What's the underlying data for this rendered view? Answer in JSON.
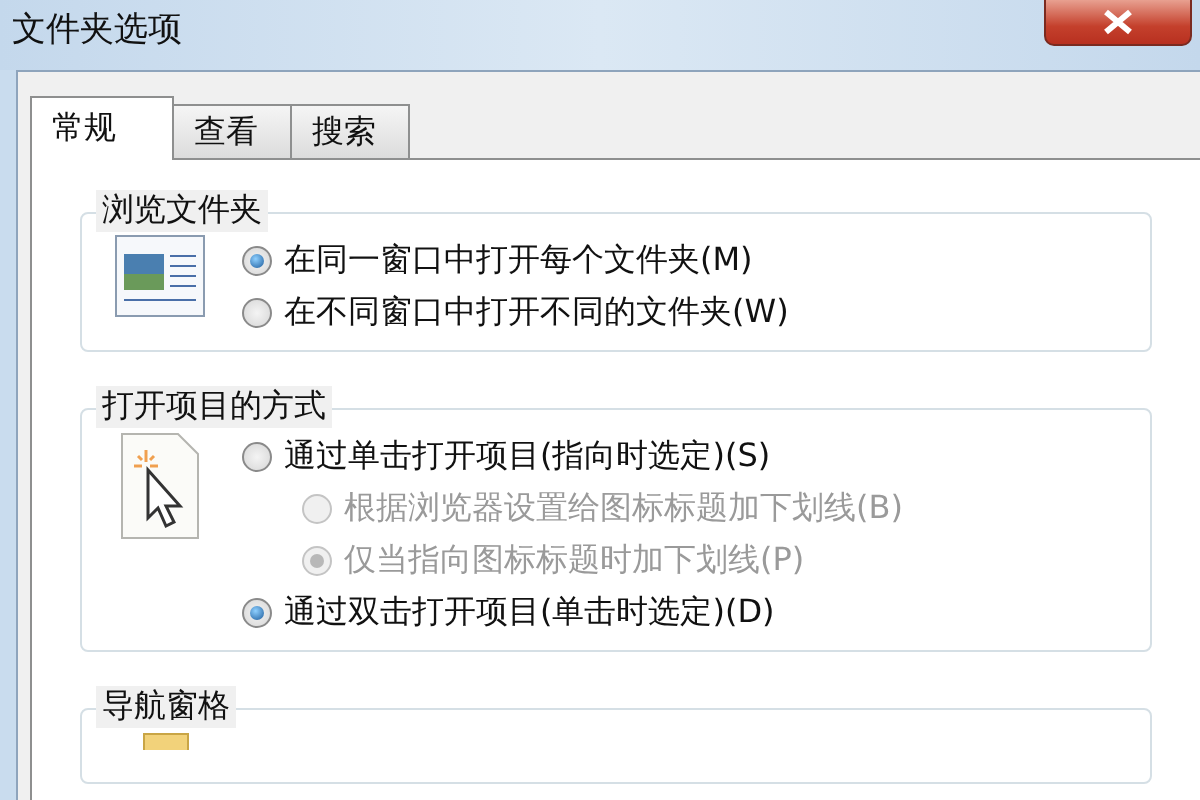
{
  "window": {
    "title": "文件夹选项"
  },
  "tabs": [
    {
      "label": "常规",
      "selected": true
    },
    {
      "label": "查看",
      "selected": false
    },
    {
      "label": "搜索",
      "selected": false
    }
  ],
  "groups": [
    {
      "title": "浏览文件夹",
      "options": [
        {
          "label": "在同一窗口中打开每个文件夹(M)",
          "selected": true,
          "disabled": false
        },
        {
          "label": "在不同窗口中打开不同的文件夹(W)",
          "selected": false,
          "disabled": false
        }
      ]
    },
    {
      "title": "打开项目的方式",
      "options": [
        {
          "label": "通过单击打开项目(指向时选定)(S)",
          "selected": false,
          "disabled": false,
          "children": [
            {
              "label": "根据浏览器设置给图标标题加下划线(B)",
              "selected": false,
              "disabled": true
            },
            {
              "label": "仅当指向图标标题时加下划线(P)",
              "selected": true,
              "disabled": true
            }
          ]
        },
        {
          "label": "通过双击打开项目(单击时选定)(D)",
          "selected": true,
          "disabled": false
        }
      ]
    },
    {
      "title": "导航窗格"
    }
  ]
}
